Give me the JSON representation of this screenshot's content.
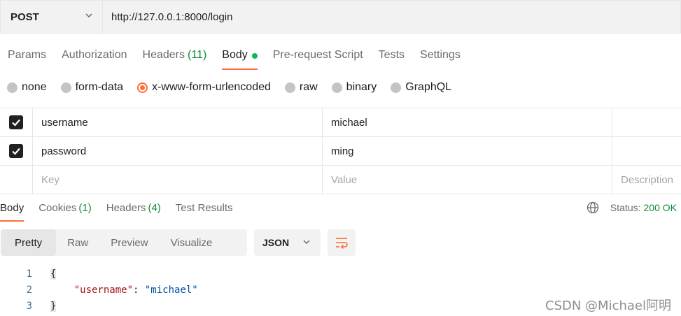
{
  "request": {
    "method": "POST",
    "url": "http://127.0.0.1:8000/login"
  },
  "tabs": [
    {
      "label": "Params",
      "count": ""
    },
    {
      "label": "Authorization",
      "count": ""
    },
    {
      "label": "Headers",
      "count": "(11)"
    },
    {
      "label": "Body",
      "count": ""
    },
    {
      "label": "Pre-request Script",
      "count": ""
    },
    {
      "label": "Tests",
      "count": ""
    },
    {
      "label": "Settings",
      "count": ""
    }
  ],
  "body_types": [
    "none",
    "form-data",
    "x-www-form-urlencoded",
    "raw",
    "binary",
    "GraphQL"
  ],
  "selected_body_type": "x-www-form-urlencoded",
  "params": {
    "rows": [
      {
        "key": "username",
        "value": "michael"
      },
      {
        "key": "password",
        "value": "ming"
      }
    ],
    "placeholder": {
      "key": "Key",
      "value": "Value",
      "description": "Description"
    }
  },
  "response": {
    "tabs": [
      {
        "label": "Body",
        "count": ""
      },
      {
        "label": "Cookies",
        "count": "(1)"
      },
      {
        "label": "Headers",
        "count": "(4)"
      },
      {
        "label": "Test Results",
        "count": ""
      }
    ],
    "status_label": "Status:",
    "status_value": "200 OK",
    "views": [
      "Pretty",
      "Raw",
      "Preview",
      "Visualize"
    ],
    "format": "JSON",
    "code": {
      "line1": "1",
      "line2": "2",
      "line3": "3",
      "open": "{",
      "key": "\"username\"",
      "colon": ": ",
      "value": "\"michael\"",
      "close": "}"
    }
  },
  "watermark": "CSDN @Michael阿明",
  "colors": {
    "accent": "#ff6c37",
    "success": "#0f8b3a",
    "active_dot": "#0cbb52"
  }
}
